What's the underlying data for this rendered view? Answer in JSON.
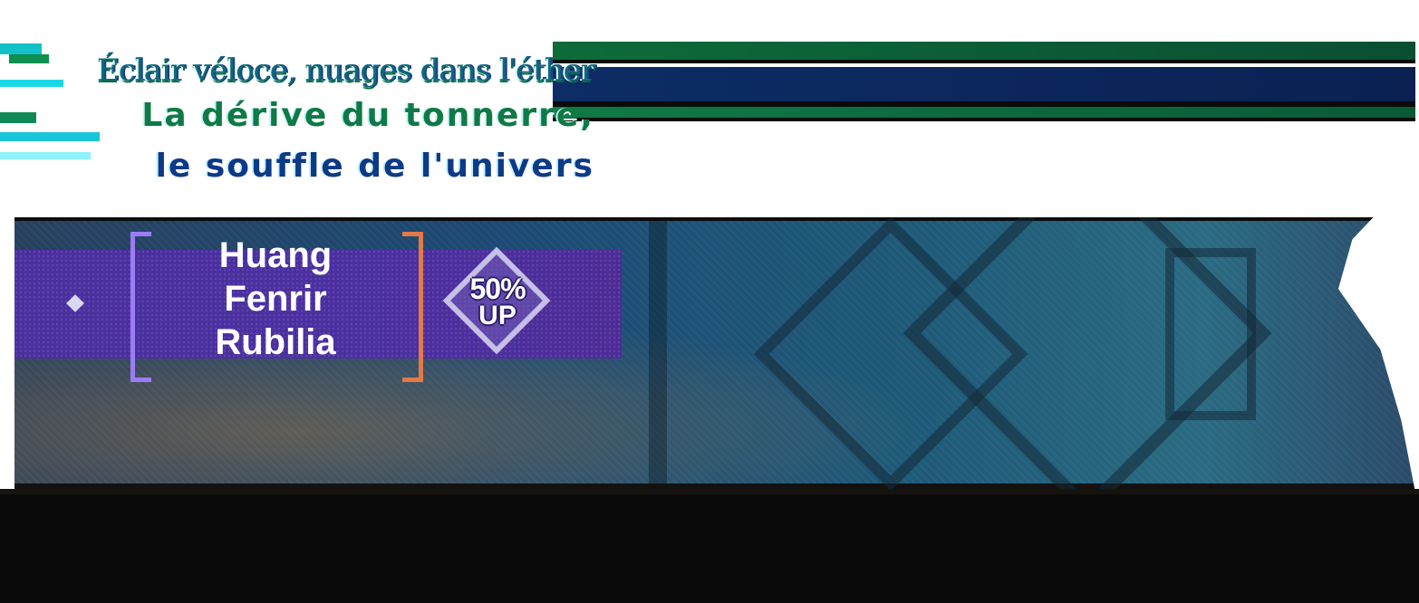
{
  "headline": {
    "line1": "Éclair véloce, nuages dans l'éther",
    "line2": "La dérive du tonnerre,",
    "line3": "le souffle de l'univers"
  },
  "banner": {
    "featured": [
      "Huang",
      "Fenrir",
      "Rubilia"
    ],
    "rate_up": {
      "percent": "50%",
      "label": "UP"
    }
  },
  "colors": {
    "accent_purple": "#4b2fa0",
    "bracket_left": "#9b7cf3",
    "bracket_right": "#e27a46",
    "headline_green": "#0e7a45",
    "headline_blue": "#0c3a86"
  },
  "icons": [
    "diamond-icon",
    "rate-up-badge-icon"
  ]
}
